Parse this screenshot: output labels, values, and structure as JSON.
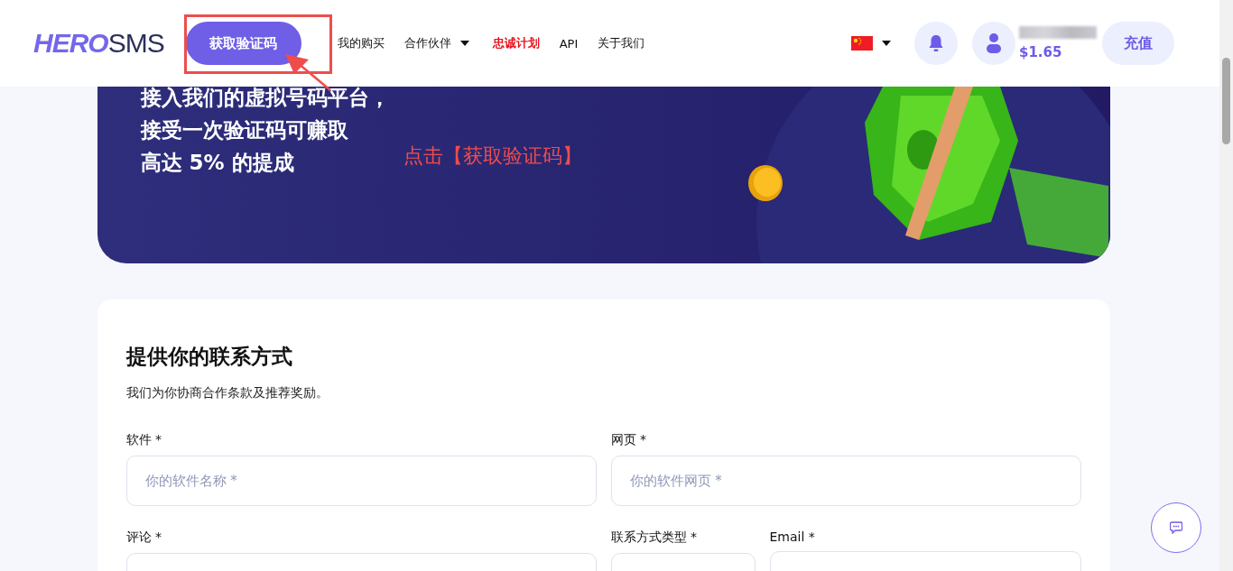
{
  "header": {
    "logo": {
      "part_1": "HERO",
      "part_2": "SMS"
    },
    "primary_button": "获取验证码",
    "nav": [
      {
        "label": "我的购买",
        "highlighted": false,
        "dropdown": false
      },
      {
        "label": "合作伙伴",
        "highlighted": false,
        "dropdown": true
      },
      {
        "label": "忠诚计划",
        "highlighted": true,
        "dropdown": false
      },
      {
        "label": "API",
        "highlighted": false,
        "dropdown": false
      },
      {
        "label": "关于我们",
        "highlighted": false,
        "dropdown": false
      }
    ],
    "balance": "$1.65",
    "top_up_button": "充值"
  },
  "hero": {
    "lines": [
      "接入我们的虚拟号码平台，",
      "接受一次验证码可赚取",
      "高达 5% 的提成"
    ]
  },
  "annotation": {
    "text": "点击【获取验证码】"
  },
  "form": {
    "title": "提供你的联系方式",
    "description": "我们为你协商合作条款及推荐奖励。",
    "rows": [
      [
        {
          "label": "软件 *",
          "placeholder": "你的软件名称 *"
        },
        {
          "label": "网页 *",
          "placeholder": "你的软件网页 *"
        }
      ],
      [
        {
          "label": "评论 *"
        },
        {
          "label": "联系方式类型 *"
        },
        {
          "label": "Email *"
        }
      ]
    ]
  }
}
